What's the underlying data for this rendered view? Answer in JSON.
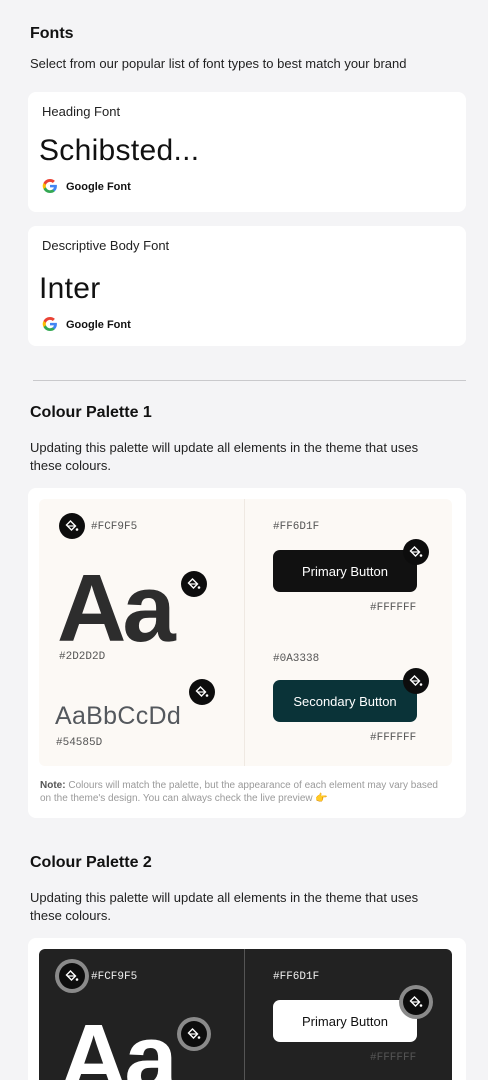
{
  "fonts": {
    "title": "Fonts",
    "desc": "Select from our popular list of font types to best match your brand",
    "heading": {
      "label": "Heading Font",
      "name": "Schibsted...",
      "source": "Google Font"
    },
    "body": {
      "label": "Descriptive Body Font",
      "name": "Inter",
      "source": "Google Font"
    }
  },
  "palette1": {
    "title": "Colour Palette 1",
    "desc": "Updating this palette will update all elements in the theme that uses these colours.",
    "bg_hex": "#FCF9F5",
    "sample_big": "Aa",
    "text_hex": "#2D2D2D",
    "sample_alpha": "AaBbCcDd",
    "muted_hex": "#54585D",
    "primary_hex": "#FF6D1F",
    "primary_label": "Primary Button",
    "primary_text_hex": "#FFFFFF",
    "secondary_hex": "#0A3338",
    "secondary_label": "Secondary Button",
    "secondary_text_hex": "#FFFFFF",
    "note_label": "Note:",
    "note_text": "Colours will match the palette, but the appearance of each element may vary based on the theme's design. You can always check the live preview 👉"
  },
  "palette2": {
    "title": "Colour Palette 2",
    "desc": "Updating this palette will update all elements in the theme that uses these colours.",
    "bg_hex": "#FCF9F5",
    "sample_big": "Aa",
    "primary_hex": "#FF6D1F",
    "primary_label": "Primary Button",
    "primary_text_hex": "#FFFFFF"
  },
  "colors": {
    "page_bg": "#f4f4f6",
    "palette1_bg": "#fcf9f5",
    "text_dark": "#2d2d2d",
    "text_muted": "#54585d",
    "primary_button": "#111111",
    "secondary_button": "#0a3338",
    "palette2_bg": "#222222"
  },
  "icons": {
    "edit": "paint-bucket-icon",
    "google": "google-g-icon"
  }
}
